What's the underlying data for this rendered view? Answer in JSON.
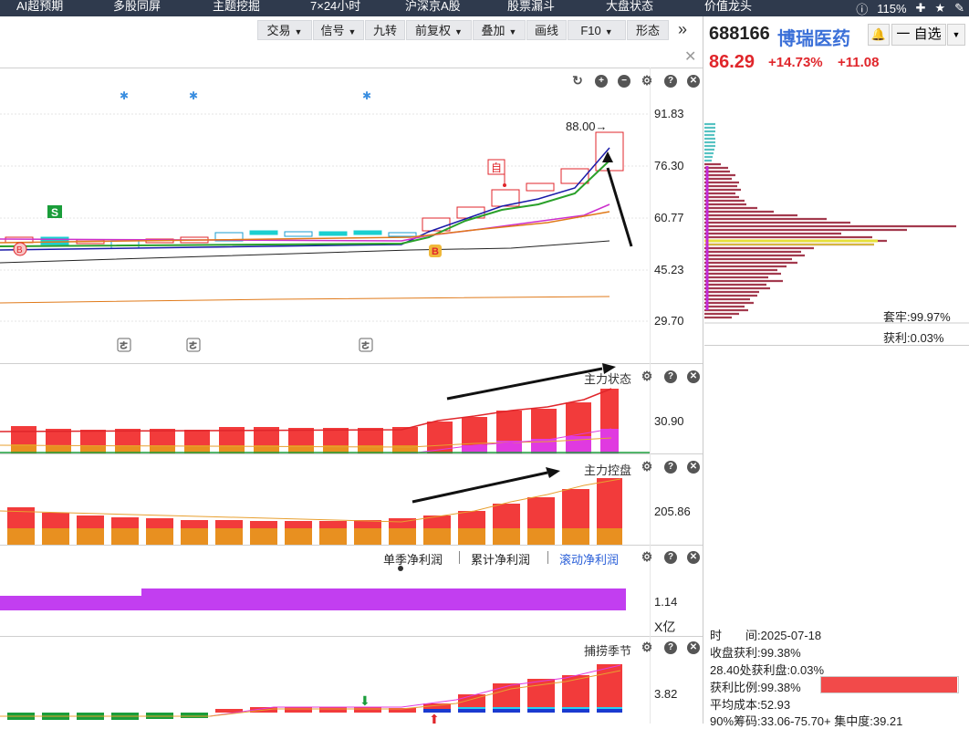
{
  "nav": {
    "items": [
      "AI超预期",
      "多股同屏",
      "主题挖掘",
      "7×24小时",
      "沪深京A股",
      "股票漏斗",
      "大盘状态",
      "价值龙头"
    ],
    "zoom": "115%",
    "icons": [
      "info-icon",
      "zoom-in-icon",
      "star-icon",
      "edit-icon"
    ]
  },
  "toolbar": {
    "buttons": [
      {
        "label": "交易",
        "dropdown": true
      },
      {
        "label": "信号",
        "dropdown": true
      },
      {
        "label": "九转",
        "dropdown": false
      },
      {
        "label": "前复权",
        "dropdown": true
      },
      {
        "label": "叠加",
        "dropdown": true
      },
      {
        "label": "画线",
        "dropdown": false
      },
      {
        "label": "F10",
        "dropdown": true
      },
      {
        "label": "形态",
        "dropdown": false
      }
    ],
    "expand_icon": "»"
  },
  "main_chart": {
    "y_labels": [
      "91.83",
      "76.30",
      "60.77",
      "45.23",
      "29.70"
    ],
    "max_annotation": "88.00→",
    "markers": {
      "sell": "S",
      "buy": "B",
      "self": "自",
      "special": "B"
    },
    "colors": {
      "up": "#e0262b",
      "down": "#1a9d3a",
      "ma5": "#1a1aa8",
      "ma10": "#2aa02a",
      "ma20": "#cc2fcc",
      "ma30": "#e07a1a"
    }
  },
  "panels": {
    "zhuli_zhuangtai": {
      "title": "主力状态",
      "y_label": "30.90"
    },
    "zhuli_kongpan": {
      "title": "主力控盘",
      "y_label": "205.86"
    },
    "profit": {
      "tabs": [
        "单季净利润",
        "累计净利润",
        "滚动净利润"
      ],
      "active_tab": 2,
      "y_label": "1.14",
      "unit": "X亿"
    },
    "buhuo": {
      "title": "捕捞季节",
      "y_label": "3.82"
    }
  },
  "quote": {
    "code": "688166",
    "name": "博瑞医药",
    "price": "86.29",
    "change_pct": "+14.73%",
    "change": "+11.08",
    "watch_label": "一 自选",
    "bell": "🔔"
  },
  "chips": {
    "tao_lao": "套牢:99.97%",
    "huo_li": "获利:0.03%",
    "time": "时　　间:2025-07-18",
    "close_profit": "收盘获利:99.38%",
    "profit_at": "28.40处获利盘:0.03%",
    "profit_ratio": "获利比例:99.38%",
    "profit_ratio_value": 0.9938,
    "avg_cost": "平均成本:52.93",
    "chip_range": "90%筹码:33.06-75.70+ 集中度:39.21"
  }
}
